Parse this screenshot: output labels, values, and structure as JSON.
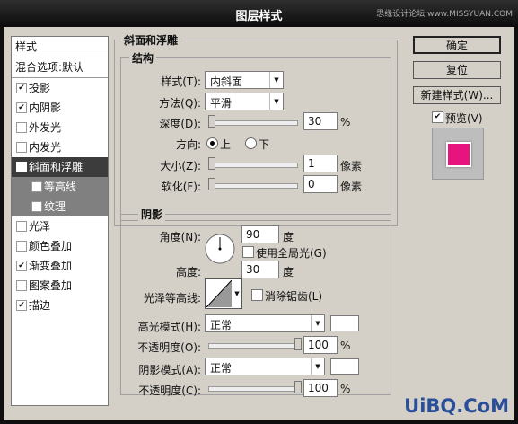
{
  "window": {
    "title": "图层样式",
    "watermark": "思缘设计论坛 www.MISSYUAN.COM"
  },
  "left_panel": {
    "header": "样式",
    "blend": "混合选项:默认",
    "items": [
      {
        "label": "投影",
        "checked": true
      },
      {
        "label": "内阴影",
        "checked": true
      },
      {
        "label": "外发光",
        "checked": false
      },
      {
        "label": "内发光",
        "checked": false
      },
      {
        "label": "斜面和浮雕",
        "checked": true
      },
      {
        "label": "等高线",
        "checked": true
      },
      {
        "label": "纹理",
        "checked": false
      },
      {
        "label": "光泽",
        "checked": false
      },
      {
        "label": "颜色叠加",
        "checked": false
      },
      {
        "label": "渐变叠加",
        "checked": true
      },
      {
        "label": "图案叠加",
        "checked": false
      },
      {
        "label": "描边",
        "checked": true
      }
    ]
  },
  "bevel": {
    "title": "斜面和浮雕",
    "structure": "结构",
    "style_label": "样式(T):",
    "style_value": "内斜面",
    "technique_label": "方法(Q):",
    "technique_value": "平滑",
    "depth_label": "深度(D):",
    "depth_value": "30",
    "depth_unit": "%",
    "direction_label": "方向:",
    "dir_up": "上",
    "dir_down": "下",
    "size_label": "大小(Z):",
    "size_value": "1",
    "size_unit": "像素",
    "soften_label": "软化(F):",
    "soften_value": "0",
    "soften_unit": "像素"
  },
  "shading": {
    "title": "阴影",
    "angle_label": "角度(N):",
    "angle_value": "90",
    "angle_unit": "度",
    "global_light": "使用全局光(G)",
    "altitude_label": "高度:",
    "altitude_value": "30",
    "altitude_unit": "度",
    "gloss_label": "光泽等高线:",
    "antialias": "消除锯齿(L)",
    "hl_mode_label": "高光模式(H):",
    "hl_mode_value": "正常",
    "hl_opacity_label": "不透明度(O):",
    "hl_opacity_value": "100",
    "hl_opacity_unit": "%",
    "sh_mode_label": "阴影模式(A):",
    "sh_mode_value": "正常",
    "sh_opacity_label": "不透明度(C):",
    "sh_opacity_value": "100",
    "sh_opacity_unit": "%"
  },
  "buttons": {
    "ok": "确定",
    "reset": "复位",
    "new_style": "新建样式(W)...",
    "preview": "预览(V)"
  },
  "brand": "UiBQ.CoM",
  "colors": {
    "preview": "#e8147e",
    "selected": "#3c3c3c"
  }
}
